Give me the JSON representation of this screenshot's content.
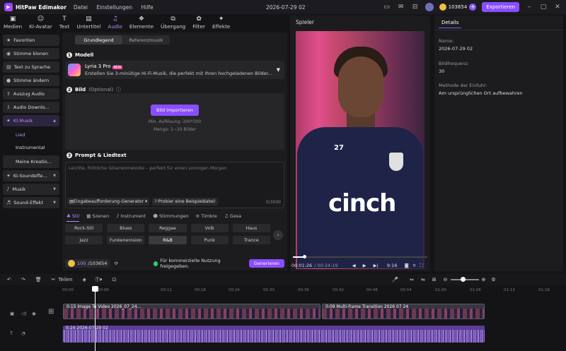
{
  "app": {
    "name": "HitPaw Edimakor",
    "menu": [
      "Datei",
      "Einstellungen",
      "Hilfe"
    ],
    "date": "2026-07-29 02",
    "credits": "103654",
    "export": "Exportieren"
  },
  "toolbar": [
    {
      "label": "Medien",
      "icon": "folder-icon"
    },
    {
      "label": "KI-Avatar",
      "icon": "avatar-icon"
    },
    {
      "label": "Text",
      "icon": "text-icon"
    },
    {
      "label": "Untertitel",
      "icon": "subtitle-icon"
    },
    {
      "label": "Audio",
      "icon": "music-icon",
      "active": true
    },
    {
      "label": "Elemente",
      "icon": "elements-icon"
    },
    {
      "label": "Übergang",
      "icon": "transition-icon"
    },
    {
      "label": "Filter",
      "icon": "filter-icon"
    },
    {
      "label": "Effekte",
      "icon": "effects-icon"
    }
  ],
  "sidebar": {
    "items": [
      "Favoriten",
      "Stimme klonen",
      "Text zu Sprache",
      "Stimme ändern",
      "Auszug Audio",
      "Audio Downlo...",
      "KI-Musik"
    ],
    "sub": [
      "Lied",
      "Instrumental"
    ],
    "my": "Meine Kreatio...",
    "groups": [
      "KI-Soundeffe...",
      "Musik",
      "Sound-Effekt"
    ]
  },
  "panel": {
    "tabs": [
      "Grundlegend",
      "Referenzmusik"
    ],
    "model": {
      "title": "Modell",
      "name": "Lyria 3 Pro",
      "badge": "NEW",
      "desc": "Erstellen Sie 3-minütige Hi-Fi-Musik, die perfekt mit Ihren hochgeladenen Bilder..."
    },
    "image": {
      "title": "Bild",
      "optional": "(Optional)",
      "button": "Bild importieren",
      "res": "Min. Auflösung: 300*300",
      "count": "Menge: 1~10 Bilder"
    },
    "prompt": {
      "title": "Prompt & Liedtext",
      "placeholder": "Leichte, fröhliche Gitarrenmelodie – perfekt für einen sonnigen Morgen",
      "gen": "Eingabeaufforderung-Generator",
      "example": "Probier eine Beispieldatei!",
      "count": "0/3000"
    },
    "cats": [
      "Stil",
      "Szenen",
      "Instrument",
      "Stimmungen",
      "Timbre",
      "Gesa"
    ],
    "tags": [
      "Rock-Stil",
      "Blues",
      "Reggae",
      "Volk",
      "Haus",
      "Jazz",
      "Funkenerosion",
      "R&B",
      "Punk",
      "Trance"
    ],
    "footer": {
      "credit": "100",
      "credit_total": "/103654",
      "commerce": "Für kommerzielle Nutzung freigegeben.",
      "generate": "Generieren"
    }
  },
  "player": {
    "title": "Spieler",
    "time": "00:01:26",
    "total": "/ 00:24:19",
    "ratio": "9:16",
    "jersey_text": "cinch",
    "jersey_num": "27"
  },
  "details": {
    "tab": "Details",
    "name_label": "Name:",
    "name": "2026-07-29 02",
    "fps_label": "Bildfrequenz:",
    "fps": "30",
    "import_label": "Methode der Einfuhr:",
    "import": "Am ursprünglichen Ort aufbewahren"
  },
  "timeline": {
    "split": "Teilen",
    "ruler": [
      "00:00",
      "00:06",
      "00:12",
      "00:18",
      "00:24",
      "00:30",
      "00:36",
      "00:42",
      "00:48",
      "00:54",
      "01:00",
      "01:06",
      "01:12",
      "01:18"
    ],
    "clip1": "0:15 Image To Video 2026_07_24...",
    "clip2": "0:09 Multi-frame Transition 2026 07 24",
    "audio": "0:24 2026-07-29 02"
  }
}
